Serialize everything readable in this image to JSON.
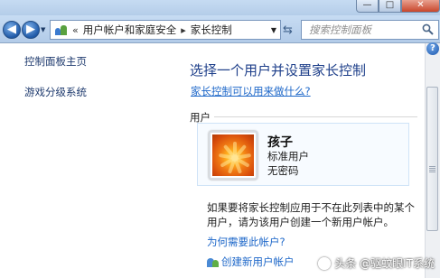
{
  "window": {
    "controls": {
      "minimize": "—",
      "maximize": "□",
      "close": "✕"
    }
  },
  "nav": {
    "back_icon": "back-arrow-icon",
    "forward_icon": "forward-arrow-icon",
    "address": {
      "overflow_marker": "«",
      "breadcrumbs": [
        "用户帐户和家庭安全",
        "家长控制"
      ],
      "separator": "▸"
    },
    "search_placeholder": "搜索控制面板"
  },
  "sidebar": {
    "items": [
      {
        "label": "控制面板主页"
      },
      {
        "label": "游戏分级系统"
      }
    ]
  },
  "main": {
    "title": "选择一个用户并设置家长控制",
    "faq_link": "家长控制可以用来做什么?",
    "users_section_label": "用户",
    "user": {
      "name": "孩子",
      "account_type": "标准用户",
      "password_status": "无密码"
    },
    "info_text": "如果要将家长控制应用于不在此列表中的某个用户，请为该用户创建一个新用户帐户。",
    "why_account_link": "为何需要此帐户?",
    "create_account_link": "创建新用户帐户"
  },
  "help": {
    "label": "?"
  },
  "watermark": {
    "text": "头条 @驱蚊眼IT系统"
  },
  "colors": {
    "title_blue": "#1e3f8a",
    "link_blue": "#1d67c9",
    "nav_gradient_top": "#c7dcf3"
  }
}
